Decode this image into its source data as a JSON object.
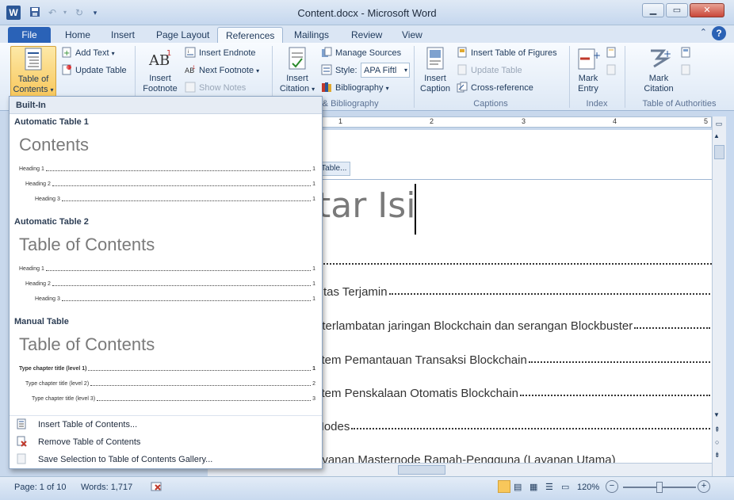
{
  "window": {
    "title": "Content.docx - Microsoft Word",
    "app_icon": "W"
  },
  "tabs": [
    "File",
    "Home",
    "Insert",
    "Page Layout",
    "References",
    "Mailings",
    "Review",
    "View"
  ],
  "active_tab": "References",
  "ribbon": {
    "toc_group": {
      "toc_button": "Table of Contents",
      "toc_line1": "Table of",
      "toc_line2": "Contents",
      "add_text": "Add Text",
      "update_table": "Update Table"
    },
    "footnotes_group": {
      "insert_footnote_line1": "Insert",
      "insert_footnote_line2": "Footnote",
      "insert_endnote": "Insert Endnote",
      "next_footnote": "Next Footnote",
      "show_notes": "Show Notes"
    },
    "citations_group": {
      "insert_citation_line1": "Insert",
      "insert_citation_line2": "Citation",
      "manage_sources": "Manage Sources",
      "style_label": "Style:",
      "style_value": "APA Fiftl",
      "bibliography": "Bibliography",
      "label": "ns & Bibliography"
    },
    "captions_group": {
      "insert_caption_line1": "Insert",
      "insert_caption_line2": "Caption",
      "insert_table_of_figures": "Insert Table of Figures",
      "update_table": "Update Table",
      "cross_reference": "Cross-reference",
      "label": "Captions"
    },
    "index_group": {
      "mark_entry_line1": "Mark",
      "mark_entry_line2": "Entry",
      "label": "Index"
    },
    "authorities_group": {
      "mark_citation_line1": "Mark",
      "mark_citation_line2": "Citation",
      "label": "Table of Authorities"
    }
  },
  "dropdown": {
    "header": "Built-In",
    "auto1": {
      "title": "Automatic Table 1",
      "heading": "Contents",
      "lines": [
        {
          "text": "Heading 1",
          "page": "1"
        },
        {
          "text": "Heading 2",
          "page": "1"
        },
        {
          "text": "Heading 3",
          "page": "1"
        }
      ]
    },
    "auto2": {
      "title": "Automatic Table 2",
      "heading": "Table of Contents",
      "lines": [
        {
          "text": "Heading 1",
          "page": "1"
        },
        {
          "text": "Heading 2",
          "page": "1"
        },
        {
          "text": "Heading 3",
          "page": "1"
        }
      ]
    },
    "manual": {
      "title": "Manual Table",
      "heading": "Table of Contents",
      "lines": [
        {
          "text": "Type chapter title (level 1)",
          "page": "1"
        },
        {
          "text": "Type chapter title (level 2)",
          "page": "2"
        },
        {
          "text": "Type chapter title (level 3)",
          "page": "3"
        }
      ]
    },
    "commands": {
      "insert_toc": "Insert Table of Contents...",
      "remove_toc": "Remove Table of Contents",
      "save_selection": "Save Selection to Table of Contents Gallery..."
    }
  },
  "document": {
    "update_tab": "e Table...",
    "title_fragment": "tar Isi",
    "toc_entries": [
      "ilitas Terjamin",
      "eterlambatan jaringan Blockchain dan serangan Blockbuster",
      "stem Pemantauan Transaksi Blockchain ",
      "stem Penskalaan Otomatis Blockchain",
      "Nodes ",
      "ayanan Masternode Ramah-Pengguna (Layanan Utama)"
    ],
    "ruler_marks": [
      "1",
      "2",
      "3",
      "4",
      "5"
    ]
  },
  "statusbar": {
    "page": "Page: 1 of 10",
    "words": "Words: 1,717",
    "zoom": "120%"
  },
  "colors": {
    "file_tab": "#2a62b7",
    "toc_highlight": "#f8c75b",
    "ribbon_bg": "#dde8f5"
  }
}
